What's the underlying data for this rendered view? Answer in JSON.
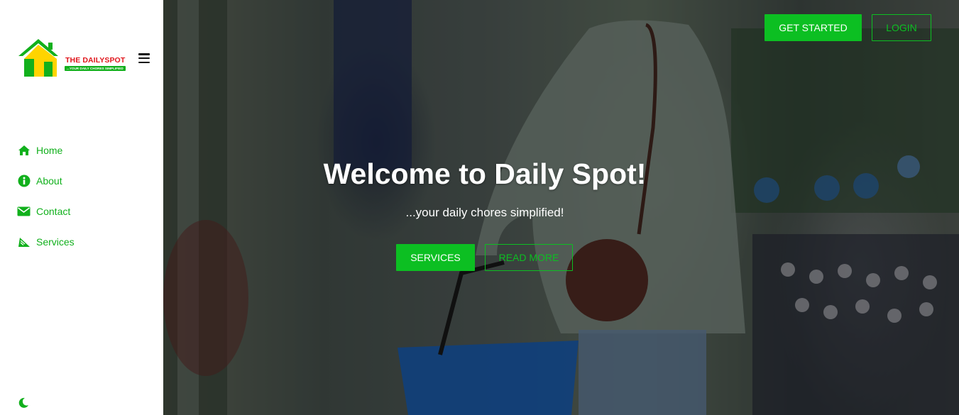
{
  "brand": {
    "name": "THE DAILYSPOT",
    "tagline": "...YOUR DAILY CHORES SIMPLIFIED",
    "colors": {
      "green": "#12b01c",
      "red": "#e0151b",
      "yellow": "#ffd400"
    }
  },
  "sidebar": {
    "menu_icon": "hamburger-icon",
    "items": [
      {
        "label": "Home",
        "icon": "home-icon"
      },
      {
        "label": "About",
        "icon": "info-icon"
      },
      {
        "label": "Contact",
        "icon": "envelope-icon"
      },
      {
        "label": "Services",
        "icon": "services-icon"
      }
    ],
    "theme_icon": "moon-icon"
  },
  "header": {
    "get_started_label": "GET STARTED",
    "login_label": "LOGIN"
  },
  "hero": {
    "title": "Welcome to Daily Spot!",
    "subtitle": "...your daily chores simplified!",
    "services_label": "SERVICES",
    "read_more_label": "READ MORE"
  },
  "colors": {
    "accent": "#0cbf22",
    "nav_text": "#11b01c"
  }
}
